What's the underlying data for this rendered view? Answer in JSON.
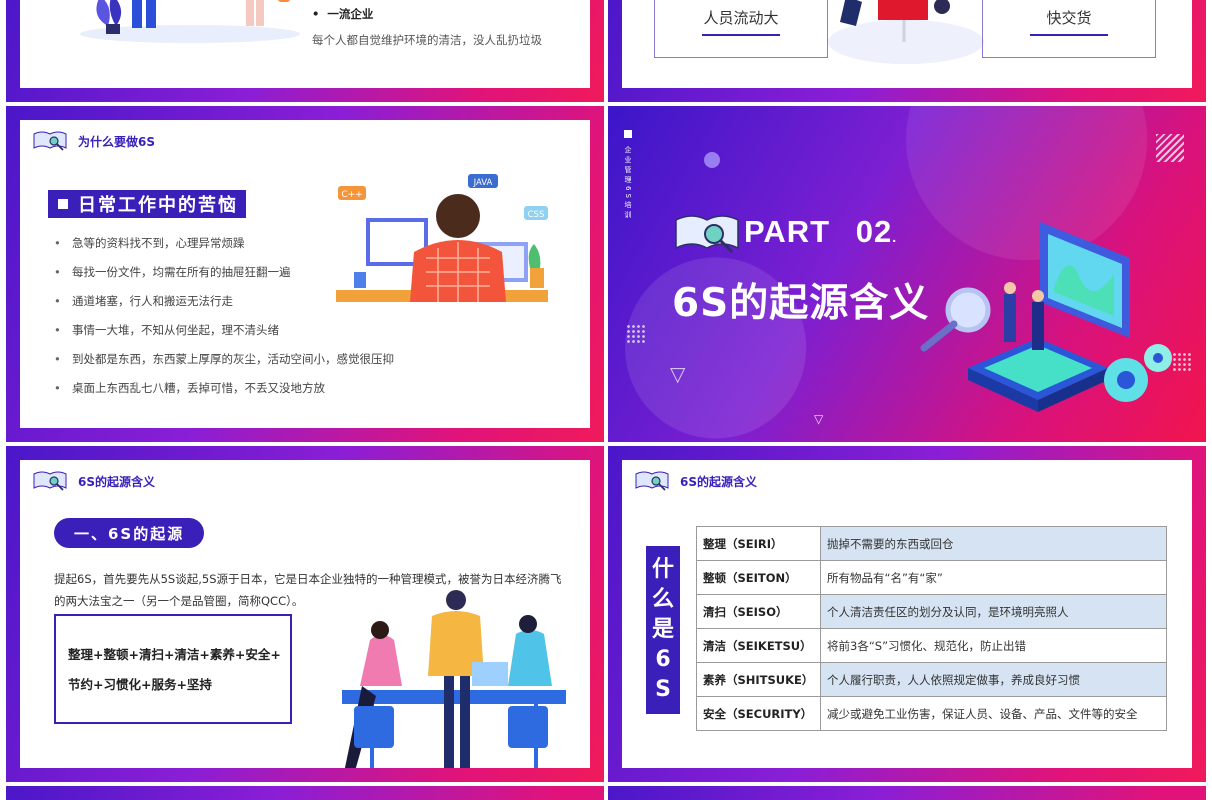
{
  "slide_top_left": {
    "bullet_title": "一流企业",
    "bullet_desc": "每个人都自觉维护环境的清洁，没人乱扔垃圾"
  },
  "slide_top_right": {
    "box_left": "人员流动大",
    "box_right": "快交货"
  },
  "slide_troubles": {
    "header": "为什么要做6S",
    "title": "日常工作中的苦恼",
    "items": [
      "急等的资料找不到，心理异常烦躁",
      "每找一份文件，均需在所有的抽屉狂翻一遍",
      "通道堵塞，行人和搬运无法行走",
      "事情一大堆，不知从何坐起，理不清头绪",
      "到处都是东西，东西蒙上厚厚的灰尘，活动空间小，感觉很压抑",
      "桌面上东西乱七八糟，丢掉可惜，不丢又没地方放"
    ],
    "tags": [
      "C++",
      "JAVA",
      "CSS"
    ]
  },
  "slide_part": {
    "vertical_text": "企业管理6S培训",
    "part_label": "PART",
    "part_num": "02",
    "title": "6S的起源含义"
  },
  "slide_origin": {
    "header": "6S的起源含义",
    "pill": "一、6S的起源",
    "para": "提起6S，首先要先从5S谈起,5S源于日本，它是日本企业独特的一种管理模式，被誉为日本经济腾飞的两大法宝之一（另一个是品管圈，简称QCC）。",
    "box_line1": "整理+整顿+清扫+清洁+素养+安全+",
    "box_line2": "节约+习惯化+服务+坚持"
  },
  "slide_definition": {
    "header": "6S的起源含义",
    "vertical_title": [
      "什",
      "么",
      "是",
      "6",
      "S"
    ],
    "rows": [
      {
        "k": "整理（SEIRI）",
        "v": "抛掉不需要的东西或回仓"
      },
      {
        "k": "整顿（SEITON）",
        "v": "所有物品有“名”有“家”"
      },
      {
        "k": "清扫（SEISO）",
        "v": "个人清洁责任区的划分及认同，是环境明亮照人"
      },
      {
        "k": "清洁（SEIKETSU）",
        "v": "将前3各“S”习惯化、规范化，防止出错"
      },
      {
        "k": "素养（SHITSUKE）",
        "v": "个人履行职责，人人依照规定做事，养成良好习惯"
      },
      {
        "k": "安全（SECURITY）",
        "v": "减少或避免工业伤害，保证人员、设备、产品、文件等的安全"
      }
    ]
  },
  "colors": {
    "accent": "#3a1fb8",
    "pink": "#e0137a",
    "table_stripe": "#d5e3f3"
  }
}
